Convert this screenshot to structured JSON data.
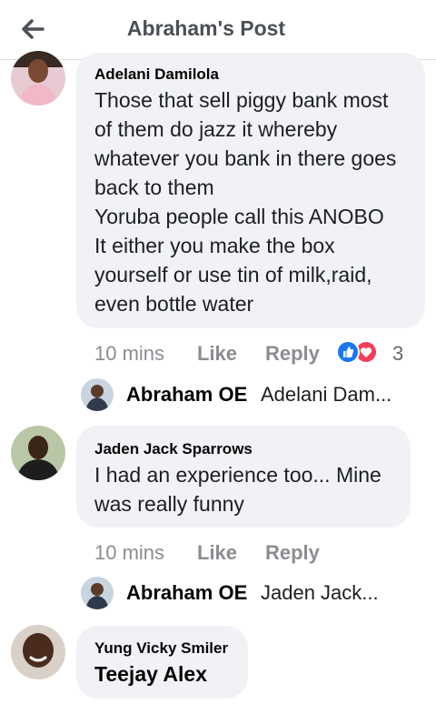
{
  "header": {
    "title": "Abraham's Post",
    "back_icon": "arrow-left-icon"
  },
  "comments": [
    {
      "author": "Adelani Damilola",
      "lines": [
        "Those that sell piggy bank most",
        "of them do jazz it whereby",
        "whatever you bank in there goes",
        "back to them",
        "Yoruba people call this ANOBO",
        "It either you make the box",
        "yourself or use tin of milk,raid,",
        "even bottle water"
      ],
      "time": "10 mins",
      "like": "Like",
      "reply": "Reply",
      "reaction_count": "3",
      "reactions": [
        "like-icon",
        "love-icon"
      ],
      "reply_preview": {
        "name": "Abraham OE",
        "text": "Adelani Dam..."
      }
    },
    {
      "author": "Jaden Jack Sparrows",
      "lines": [
        "I had an experience too... Mine",
        "was really funny"
      ],
      "time": "10 mins",
      "like": "Like",
      "reply": "Reply",
      "reply_preview": {
        "name": "Abraham OE",
        "text": "Jaden Jack..."
      }
    },
    {
      "author": "Yung Vicky Smiler",
      "tag": "Teejay Alex"
    }
  ],
  "colors": {
    "bubble": "#f0f2f5",
    "like_blue": "#1877f2",
    "love_red": "#f33e58",
    "meta_gray": "#8a8d91"
  }
}
